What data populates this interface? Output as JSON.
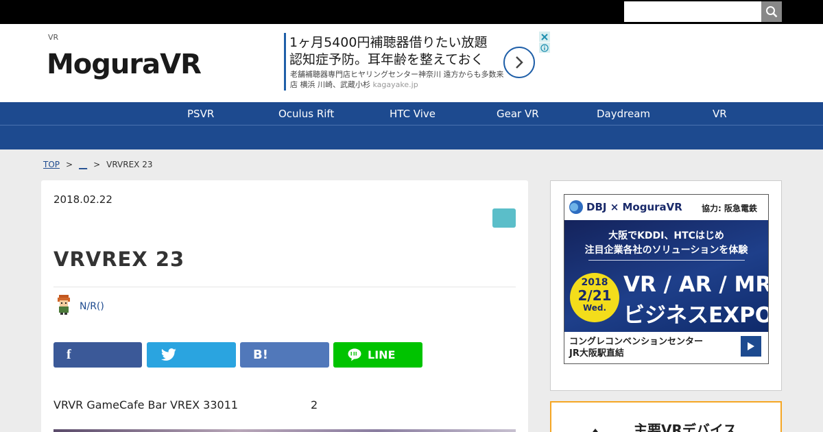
{
  "search": {
    "placeholder": ""
  },
  "header": {
    "tagline": "VR",
    "logo": "MoguraVR"
  },
  "ad": {
    "headline": "1ヶ月5400円補聴器借りたい放題\n認知症予防。耳年齢を整えておく",
    "body": "老舗補聴器専門店ヒヤリングセンター神奈川 遠方からも多数来店 横浜 川崎、武蔵小杉",
    "domain": "kagayake.jp"
  },
  "nav": {
    "items": [
      {
        "label": "PSVR"
      },
      {
        "label": "Oculus Rift"
      },
      {
        "label": "HTC Vive"
      },
      {
        "label": "Gear VR"
      },
      {
        "label": "Daydream"
      },
      {
        "label": "VR"
      }
    ]
  },
  "breadcrumb": {
    "home": "TOP",
    "sep1": ">",
    "category": "__",
    "sep2": ">",
    "current": "VRVREX 23"
  },
  "article": {
    "date": "2018.02.22",
    "title": "VRVREX 23",
    "author": "N/R()",
    "lead": "VRVR GameCafe Bar VREX 33011",
    "lead_number": "2"
  },
  "share": {
    "facebook": "f",
    "twitter": "",
    "hatena": "B!",
    "line": "LINE"
  },
  "sidebar": {
    "banner": {
      "brand": "DBJ × MoguraVR",
      "cooperation": "協力: 阪急電鉄",
      "line1": "大阪でKDDI、HTCはじめ",
      "line2": "注目企業各社のソリューションを体験",
      "year": "2018",
      "date": "2/21",
      "day": "Wed.",
      "expo1": "VR / AR / MR",
      "expo2": "ビジネスEXPO",
      "venue": "コングレコンベンションセンター\nJR大阪駅直結"
    },
    "devices_heading": "主要VRデバイス"
  },
  "colors": {
    "nav": "#1d4a8f",
    "tag": "#5bbec9",
    "facebook": "#3b5998",
    "twitter": "#2aa4e0",
    "hatena": "#5178ba",
    "line": "#00c300"
  }
}
